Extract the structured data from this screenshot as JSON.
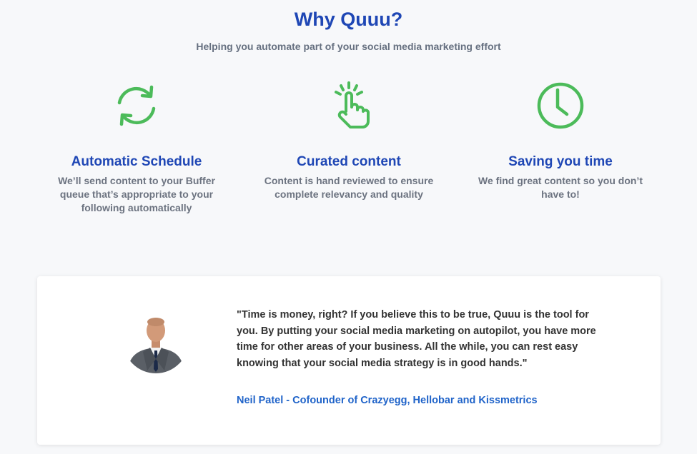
{
  "header": {
    "title": "Why Quuu?",
    "subtitle": "Helping you automate part of your social media marketing effort"
  },
  "features": [
    {
      "icon": "refresh-icon",
      "title": "Automatic Schedule",
      "description": "We’ll send content to your Buffer queue that’s appropriate to your following automatically"
    },
    {
      "icon": "hand-pointer-icon",
      "title": "Curated content",
      "description": "Content is hand reviewed to ensure complete relevancy and quality"
    },
    {
      "icon": "clock-icon",
      "title": "Saving you time",
      "description": "We find great content so you don’t have to!"
    }
  ],
  "testimonial": {
    "quote": "\"Time is money, right? If you believe this to be true, Quuu is the tool for you. By putting your social media marketing on autopilot, you have more time for other areas of your business. All the while, you can rest easy knowing that your social media strategy is in good hands.\"",
    "author": "Neil Patel - Cofounder of Crazyegg, Hellobar and Kissmetrics"
  },
  "colors": {
    "heading": "#1f47b5",
    "icon_green": "#4cbb5a",
    "link_blue": "#1f63c9"
  }
}
